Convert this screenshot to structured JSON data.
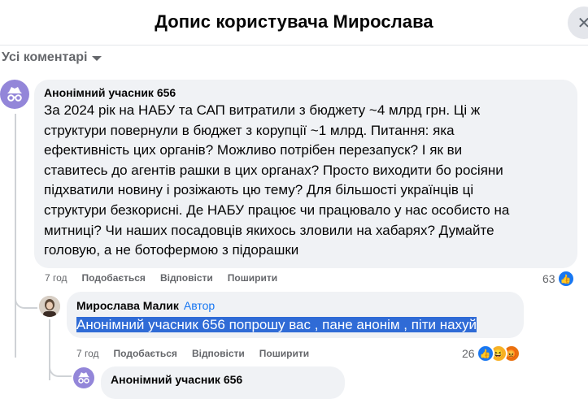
{
  "header": {
    "title": "Допис користувача Мирослава"
  },
  "sort": {
    "label": "Усі коментарі"
  },
  "comments": [
    {
      "author": "Анонімний учасник 656",
      "text": [
        "За 2024 рік на НАБУ та САП витратили з бюджету ~4 млрд грн. Ці ж",
        "структури повернули в бюджет з корупції ~1 млрд. Питання: яка",
        "ефективність цих органів? Можливо потрібен перезапуск? І як ви",
        "ставитесь до агентів рашки в цих органах? Просто виходити бо росіяни",
        "підхватили новину і розіжають цю тему? Для більшості українців ці",
        "структури безкорисні. Де НАБУ працює чи працювало у нас особисто на",
        "митниці? Чи наших посадовців якихось зловили на хабарях? Думайте",
        "головую, а не ботофермою з підорашки"
      ],
      "time": "7 год",
      "like_label": "Подобається",
      "reply_label": "Відповісти",
      "share_label": "Поширити",
      "reaction_count": "63"
    },
    {
      "author": "Мирослава Малик",
      "badge": "Автор",
      "text": "Анонімний учасник 656 попрошу вас , пане анонім , піти нахуй",
      "time": "7 год",
      "like_label": "Подобається",
      "reply_label": "Відповісти",
      "share_label": "Поширити",
      "reaction_count": "26"
    },
    {
      "author": "Анонімний учасник 656"
    }
  ],
  "icons": {
    "close": "close-icon",
    "anon": "incognito-icon",
    "like": "like-icon",
    "haha": "haha-icon",
    "angry": "angry-icon"
  },
  "colors": {
    "like_blue": "#1877f2",
    "highlight": "#2f6bd6",
    "anon_avatar": "#9386d9"
  }
}
